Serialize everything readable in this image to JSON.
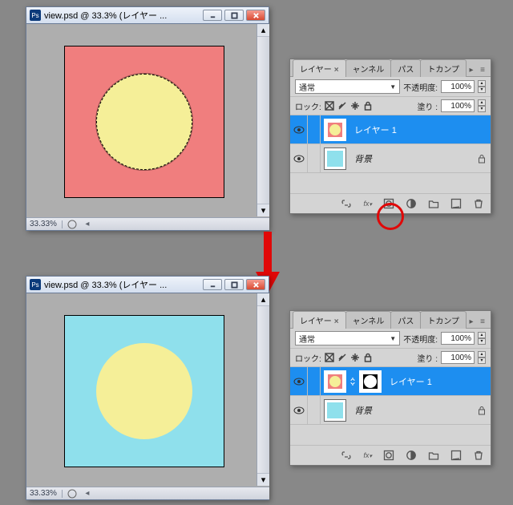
{
  "doc_windows": {
    "title": "view.psd @ 33.3% (レイヤー ...",
    "zoom_label": "33.33%"
  },
  "canvas_colors": {
    "before_bg": "#f07e7e",
    "after_bg": "#8fe0ec",
    "circle": "#f5ef98"
  },
  "panel_tabs": {
    "layers": "レイヤー",
    "channels": "ャンネル",
    "paths": "パス",
    "comp": "トカンプ"
  },
  "panel_top": {
    "blend_mode": "通常",
    "opacity_label": "不透明度:",
    "opacity_value": "100%",
    "lock_label": "ロック:",
    "fill_label": "塗り :",
    "fill_value": "100%"
  },
  "layers_before": [
    {
      "name": "レイヤー 1",
      "selected": true,
      "thumb": "salmon-circle",
      "mask": null,
      "locked": false
    },
    {
      "name": "背景",
      "selected": false,
      "thumb": "cyan-solid",
      "mask": null,
      "locked": true
    }
  ],
  "layers_after": [
    {
      "name": "レイヤー 1",
      "selected": true,
      "thumb": "salmon-circle",
      "mask": "circle",
      "locked": false
    },
    {
      "name": "背景",
      "selected": false,
      "thumb": "cyan-solid",
      "mask": null,
      "locked": true
    }
  ]
}
